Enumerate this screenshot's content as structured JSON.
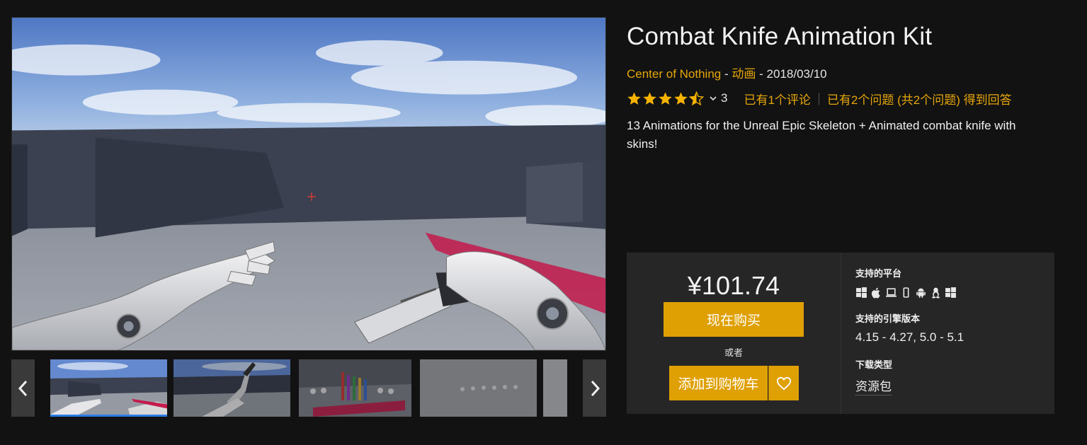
{
  "product": {
    "title": "Combat Knife Animation Kit",
    "seller": "Center of Nothing",
    "category": "动画",
    "release_date": "2018/03/10",
    "dash": "-",
    "rating_value": 4.5,
    "rating_count": "3",
    "reviews_text": "已有1个评论",
    "questions_text": "已有2个问题 (共2个问题) 得到回答",
    "description": "13 Animations for the Unreal Epic Skeleton + Animated combat knife with skins!"
  },
  "purchase": {
    "price": "¥101.74",
    "buy_now_label": "现在购买",
    "or_label": "或者",
    "add_to_cart_label": "添加到购物车"
  },
  "specs": {
    "platforms_label": "支持的平台",
    "platform_icons": [
      "windows-icon",
      "apple-icon",
      "laptop-icon",
      "mobile-icon",
      "android-icon",
      "linux-icon",
      "windows-icon"
    ],
    "engine_label": "支持的引擎版本",
    "engine_versions": "4.15 - 4.27, 5.0 - 5.1",
    "download_label": "下载类型",
    "download_type": "资源包"
  },
  "gallery": {
    "thumbnail_count": 5,
    "selected_index": 0
  },
  "colors": {
    "accent": "#dfa004",
    "link": "#e6a60a",
    "background": "#121212",
    "panel": "#262626",
    "star": "#f5b301"
  }
}
